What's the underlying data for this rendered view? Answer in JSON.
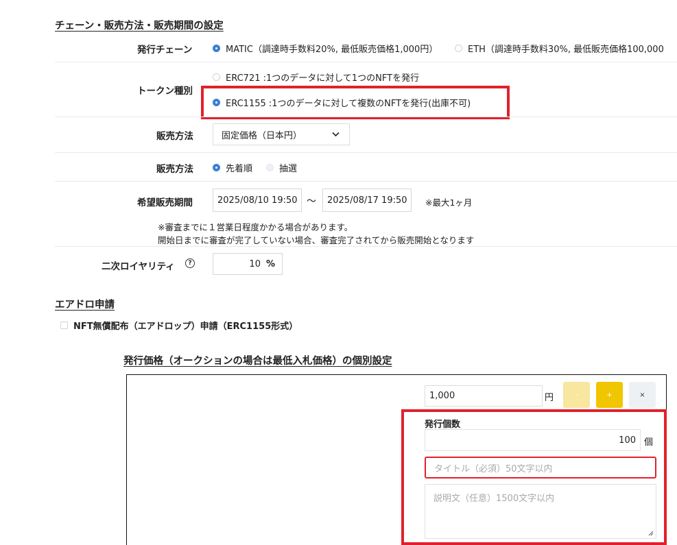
{
  "sections": {
    "chain_title": "チェーン・販売方法・販売期間の設定",
    "airdrop_title": "エアドロ申請",
    "price_title": "発行価格（オークションの場合は最低入札価格）の個別設定"
  },
  "chain": {
    "label": "発行チェーン",
    "option_matic": "MATIC（調達時手数料20%, 最低販売価格1,000円）",
    "option_eth": "ETH（調達時手数料30%, 最低販売価格100,000"
  },
  "token": {
    "label": "トークン種別",
    "option_721": "ERC721 :1つのデータに対して1つのNFTを発行",
    "option_1155": "ERC1155 :1つのデータに対して複数のNFTを発行(出庫不可)"
  },
  "sales_method": {
    "label": "販売方法",
    "selected": "固定価格（日本円）"
  },
  "sales_order": {
    "label": "販売方法",
    "option_first": "先着順",
    "option_lottery": "抽選"
  },
  "period": {
    "label": "希望販売期間",
    "start": "2025/08/10 19:50",
    "tilde": "〜",
    "end": "2025/08/17 19:50",
    "max_note": "※最大1ヶ月",
    "note_line1": "※審査までに１営業日程度かかる場合があります。",
    "note_line2": "開始日までに審査が完了していない場合、審査完了されてから販売開始となります"
  },
  "royalty": {
    "label": "二次ロイヤリティ",
    "help_glyph": "?",
    "value": "10",
    "unit": "%"
  },
  "airdrop": {
    "checkbox_label": "NFT無償配布（エアドロップ）申請（ERC1155形式）"
  },
  "price_item": {
    "price": "1,000",
    "yen": "円",
    "minus": "-",
    "plus": "+",
    "remove": "×",
    "quantity_label": "発行個数",
    "quantity": "100",
    "quantity_unit": "個",
    "title_placeholder": "タイトル（必須）50文字以内",
    "desc_placeholder": "説明文（任意）1500文字以内"
  },
  "colors": {
    "accent_blue": "#3b7fd4",
    "highlight_red": "#e0212b",
    "plus_yellow": "#f0c600",
    "minus_yellow_light": "#f7e7a0"
  }
}
